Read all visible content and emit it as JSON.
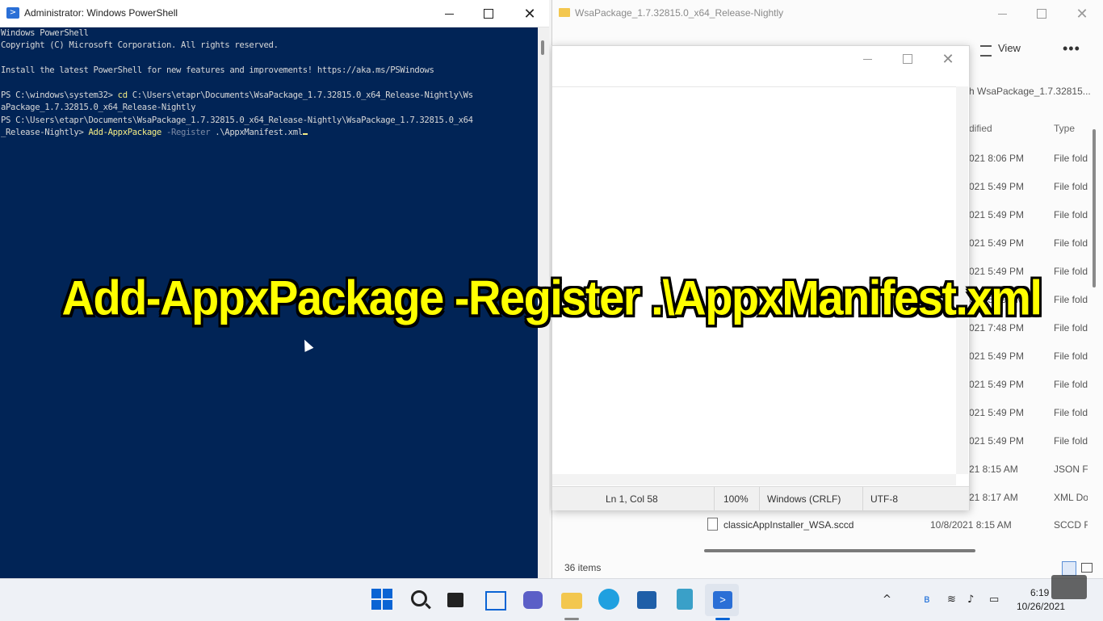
{
  "powershell": {
    "title": "Administrator: Windows PowerShell",
    "lines": [
      "Windows PowerShell",
      "Copyright (C) Microsoft Corporation. All rights reserved.",
      "",
      "Install the latest PowerShell for new features and improvements! https://aka.ms/PSWindows",
      "",
      "PS C:\\windows\\system32> "
    ],
    "cmd1_prompt": "PS C:\\windows\\system32> ",
    "cmd1_verb": "cd",
    "cmd1_arg": " C:\\Users\\etapr\\Documents\\WsaPackage_1.7.32815.0_x64_Release-Nightly\\Ws",
    "cmd1_cont": "aPackage_1.7.32815.0_x64_Release-Nightly",
    "cmd2_prompt_a": "PS C:\\Users\\etapr\\Documents\\WsaPackage_1.7.32815.0_x64_Release-Nightly\\WsaPackage_1.7.32815.0_x64",
    "cmd2_prompt_b": "_Release-Nightly> ",
    "cmd2_verb": "Add-AppxPackage",
    "cmd2_param": " -Register",
    "cmd2_arg": " .\\AppxManifest.xml"
  },
  "explorer": {
    "title": "WsaPackage_1.7.32815.0_x64_Release-Nightly",
    "view_label": "View",
    "more_label": "•••",
    "search_text": "h WsaPackage_1.7.32815...",
    "col_modified": "dified",
    "col_type": "Type",
    "rows": [
      {
        "mod": "021 8:06 PM",
        "type": "File folder"
      },
      {
        "mod": "021 5:49 PM",
        "type": "File folder"
      },
      {
        "mod": "021 5:49 PM",
        "type": "File folder"
      },
      {
        "mod": "021 5:49 PM",
        "type": "File folder"
      },
      {
        "mod": "021 5:49 PM",
        "type": "File folder"
      },
      {
        "mod": "021 5:49 PM",
        "type": "File folder"
      },
      {
        "mod": "021 7:48 PM",
        "type": "File folder"
      },
      {
        "mod": "021 5:49 PM",
        "type": "File folder"
      },
      {
        "mod": "021 5:49 PM",
        "type": "File folder"
      },
      {
        "mod": "021 5:49 PM",
        "type": "File folder"
      },
      {
        "mod": "021 5:49 PM",
        "type": "File folder"
      },
      {
        "mod": "21 8:15 AM",
        "type": "JSON File"
      },
      {
        "mod": "21 8:17 AM",
        "type": "XML Document"
      }
    ],
    "last_name": "classicAppInstaller_WSA.sccd",
    "last_date": "10/8/2021 8:15 AM",
    "last_type": "SCCD File",
    "item_count": "36 items"
  },
  "notepad": {
    "status_pos": "Ln 1, Col 58",
    "status_zoom": "100%",
    "status_eol": "Windows (CRLF)",
    "status_enc": "UTF-8"
  },
  "caption": "Add-AppxPackage -Register .\\AppxManifest.xml",
  "taskbar": {
    "time": "6:19",
    "date": "10/26/2021"
  }
}
